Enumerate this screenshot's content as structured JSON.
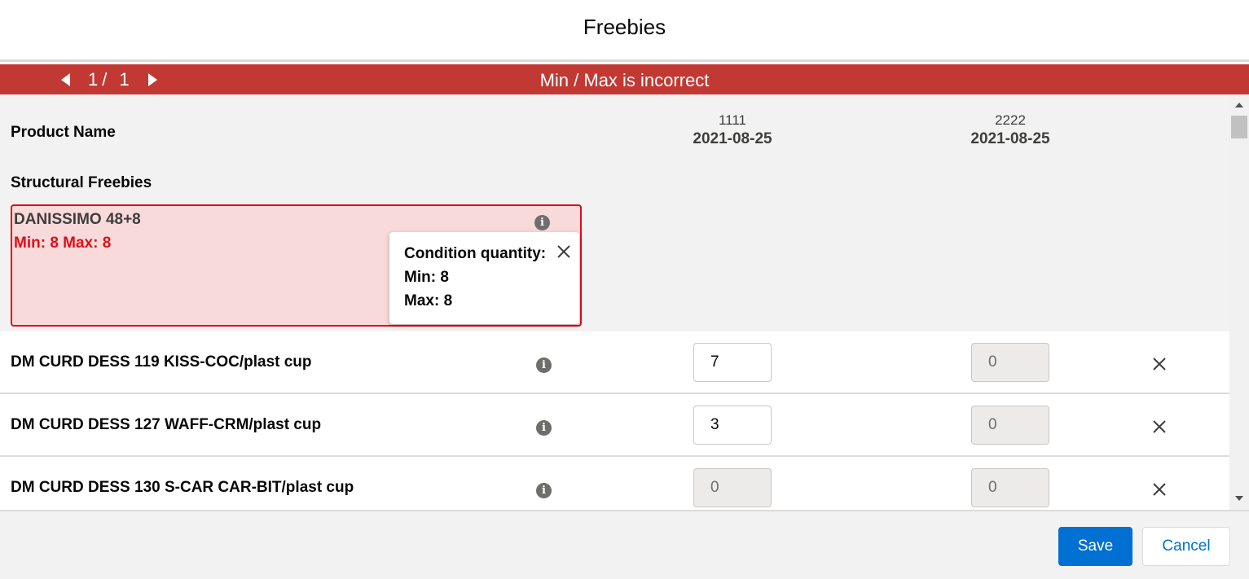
{
  "modal": {
    "title": "Freebies"
  },
  "error_bar": {
    "pager": {
      "current": "1",
      "separator": "/",
      "total": "1"
    },
    "message": "Min / Max is incorrect"
  },
  "table": {
    "product_column": "Product Name",
    "date_columns": [
      {
        "code": "1111",
        "date": "2021-08-25"
      },
      {
        "code": "2222",
        "date": "2021-08-25"
      }
    ]
  },
  "section": {
    "title": "Structural Freebies",
    "error_product": {
      "name": "DANISSIMO 48+8",
      "min_max": "Min: 8 Max: 8"
    }
  },
  "popover": {
    "title": "Condition quantity:",
    "min": "Min: 8",
    "max": "Max: 8"
  },
  "rows": [
    {
      "name": "DM CURD DESS 119 KISS-COC/plast cup",
      "qty1": "7",
      "qty2": "0"
    },
    {
      "name": "DM CURD DESS 127 WAFF-CRM/plast cup",
      "qty1": "3",
      "qty2": "0"
    },
    {
      "name": "DM CURD DESS 130 S-CAR CAR-BIT/plast cup",
      "qty1": "0",
      "qty2": "0"
    }
  ],
  "footer": {
    "save_label": "Save",
    "cancel_label": "Cancel"
  },
  "colors": {
    "error": "#c23934",
    "brand": "#0070d2",
    "error_border": "#e00e1a"
  },
  "icons": {
    "info": "info-icon",
    "close": "close-icon",
    "remove": "remove-row-icon"
  }
}
